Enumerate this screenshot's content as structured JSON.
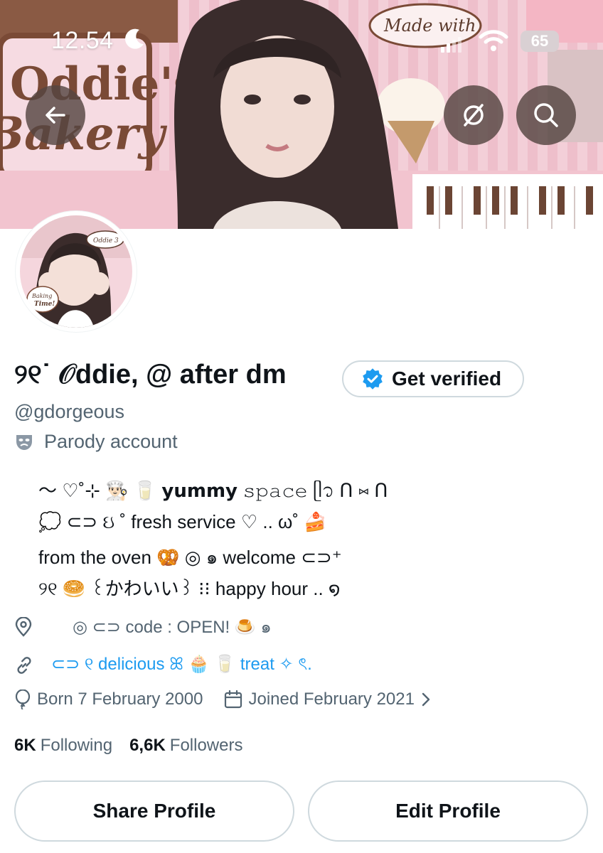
{
  "status_bar": {
    "time": "12.54",
    "battery": "65"
  },
  "banner": {
    "text_left_top": "Oddie's",
    "text_left_bottom": "Bakery",
    "text_bubble": "Made with"
  },
  "avatar": {
    "bubble_text": "Oddie 3",
    "badge_text_1": "Baking",
    "badge_text_2": "Time!"
  },
  "profile": {
    "display_name": "୨୧˙ 𝒪ddie, @ after dm",
    "get_verified_label": "Get verified",
    "handle": "@gdorgeous",
    "parody_label": "Parody account"
  },
  "bio": {
    "line1": "〜 ♡˚⊹ 👨🏻‍🍳 🥛 𝘆𝘂𝗺𝗺𝘆 𝚜𝚙𝚊𝚌𝚎 ᥫ᭡ ᑎ ⑅ ᑎ",
    "line2": "💭 ⊂⊃ ઇ ˚ fresh service ♡ .. ω˚ 🍰",
    "line3": "from the oven 🥨 ◎ ๑ welcome ⊂⊃⁺",
    "line4": "୨୧ 🥯 ꒰かわいい꒱ ⁝⁝ happy hour .. ໑"
  },
  "meta": {
    "location": "◎ ⊂⊃ code : OPEN! 🍮 ๑",
    "website": "⊂⊃ ୧ delicious ꕤ 🧁 🥛 treat ✧ ৎ.",
    "born": "Born 7 February 2000",
    "joined": "Joined February 2021"
  },
  "stats": {
    "following_count": "6K",
    "following_label": "Following",
    "followers_count": "6,6K",
    "followers_label": "Followers"
  },
  "actions": {
    "share": "Share Profile",
    "edit": "Edit Profile"
  },
  "colors": {
    "link": "#1d9bf0",
    "secondary_text": "#536471",
    "verified_badge": "#1d9bf0",
    "banner_pink": "#f3cfd8"
  },
  "icons": [
    "back-arrow-icon",
    "unfollow-icon",
    "search-icon",
    "verified-badge-icon",
    "parody-mask-icon",
    "location-pin-icon",
    "link-icon",
    "birthday-balloon-icon",
    "calendar-icon",
    "chevron-right-icon",
    "moon-icon",
    "signal-icon",
    "wifi-icon"
  ]
}
